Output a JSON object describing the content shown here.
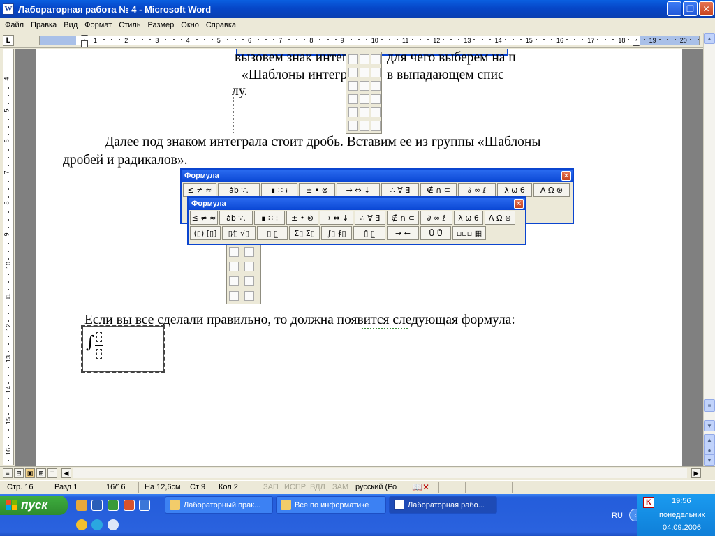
{
  "window": {
    "title": "Лабораторная работа № 4 - Microsoft Word",
    "app_icon_letter": "W"
  },
  "menu": [
    "Файл",
    "Правка",
    "Вид",
    "Формат",
    "Стиль",
    "Размер",
    "Окно",
    "Справка"
  ],
  "ruler": {
    "tab_selector": "L",
    "numbers": [
      "1",
      "2",
      "3",
      "4",
      "5",
      "6",
      "7",
      "8",
      "9",
      "10",
      "11",
      "12",
      "13",
      "14",
      "15",
      "16",
      "17",
      "18",
      "19",
      "20"
    ],
    "vnumbers": [
      "4",
      "5",
      "6",
      "7",
      "8",
      "9",
      "10",
      "11",
      "12",
      "13",
      "14",
      "15",
      "16"
    ]
  },
  "document": {
    "line1": "вызовем знак интегр",
    "line1b": "для чего выберем на п",
    "line2": "«Шаблоны интегра",
    "line2b": "в выпадающем спис",
    "line3": "лу.",
    "para2_line1": "Далее под знаком интеграла стоит дробь. Вставим ее из группы «Шаблоны",
    "para2_line2": "дробей и радикалов».",
    "para3": "Если вы все сделали правильно, то должна появится следующая формула:"
  },
  "formula_toolbar_back": {
    "title": "Формула",
    "row1": [
      "≤ ≠ ≈",
      "ȧb ∵.",
      "∎ ∷ ⁝",
      "± • ⊗",
      "→ ⇔ ↓",
      "∴ ∀ ∃",
      "∉ ∩ ⊂",
      "∂ ∞ ℓ",
      "λ ω θ",
      "Λ Ω ⊛"
    ]
  },
  "formula_toolbar_front": {
    "title": "Формула",
    "row1": [
      "≤ ≠ ≈",
      "ȧb ∵.",
      "∎ ∷ ⁝",
      "± • ⊗",
      "→ ⇔ ↓",
      "∴ ∀ ∃",
      "∉ ∩ ⊂",
      "∂ ∞ ℓ",
      "λ ω θ",
      "Λ Ω ⊛"
    ],
    "row2": [
      "(▯) [▯]",
      "▯⁄▯ √▯",
      "▯ ▯̲",
      "Σ▯ Σ▯",
      "∫▯ ∮▯",
      "▯̄ ▯̲",
      "→ ←",
      "Ū Ů",
      "▫▫▫ ▦"
    ]
  },
  "statusbar": {
    "page": "Стр. 16",
    "section": "Разд 1",
    "pages": "16/16",
    "at": "На 12,6см",
    "line": "Ст 9",
    "col": "Кол 2",
    "rec": "ЗАП",
    "trk": "ИСПР",
    "ext": "ВДЛ",
    "ovr": "ЗАМ",
    "language": "русский (Ро"
  },
  "taskbar": {
    "start": "пуск",
    "buttons": [
      {
        "label": "Лабораторный прак..."
      },
      {
        "label": "Все по информатике"
      },
      {
        "label": "Лабораторная рабо..."
      }
    ],
    "lang": "RU",
    "time": "19:56",
    "day": "понедельник",
    "date": "04.09.2006"
  },
  "colors": {
    "titlebar": "#0a46d4",
    "taskbar": "#245ddb",
    "start": "#3fae3f",
    "tray": "#0f7fd8"
  }
}
